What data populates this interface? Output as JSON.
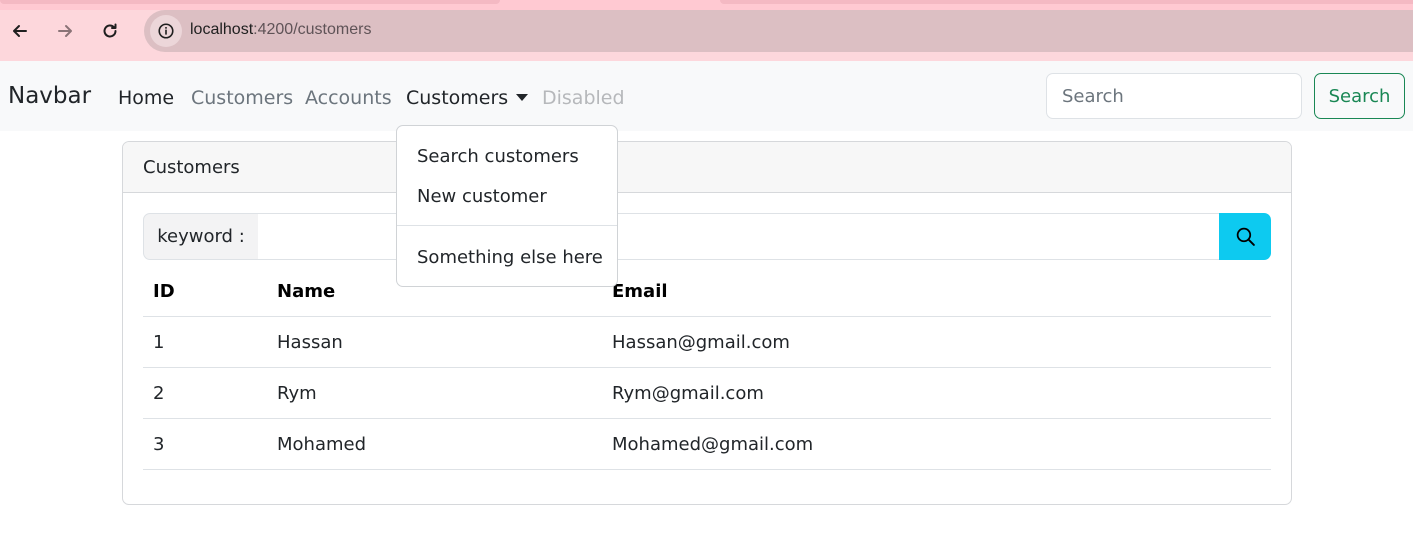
{
  "browser": {
    "url_host": "localhost",
    "url_path": ":4200/customers",
    "icons": [
      "back-arrow-icon",
      "forward-arrow-icon",
      "reload-icon",
      "site-info-icon"
    ]
  },
  "navbar": {
    "brand": "Navbar",
    "links": {
      "home": "Home",
      "customers": "Customers",
      "accounts": "Accounts",
      "customers_dropdown": "Customers",
      "disabled": "Disabled"
    },
    "search_placeholder": "Search",
    "search_button": "Search"
  },
  "dropdown": {
    "items": [
      "Search customers",
      "New customer",
      "Something else here"
    ]
  },
  "card": {
    "title": "Customers",
    "keyword_label": "keyword :",
    "keyword_value": "",
    "search_icon": "magnifier-icon"
  },
  "table": {
    "headers": [
      "ID",
      "Name",
      "Email"
    ],
    "rows": [
      [
        "1",
        "Hassan",
        "Hassan@gmail.com"
      ],
      [
        "2",
        "Rym",
        "Rym@gmail.com"
      ],
      [
        "3",
        "Mohamed",
        "Mohamed@gmail.com"
      ]
    ]
  },
  "colors": {
    "chrome_bg": "#fdd7dc",
    "address_bar_bg": "#dcbfc3",
    "navbar_bg": "#f8f9fa",
    "success": "#198754",
    "info": "#0dcaf0"
  }
}
